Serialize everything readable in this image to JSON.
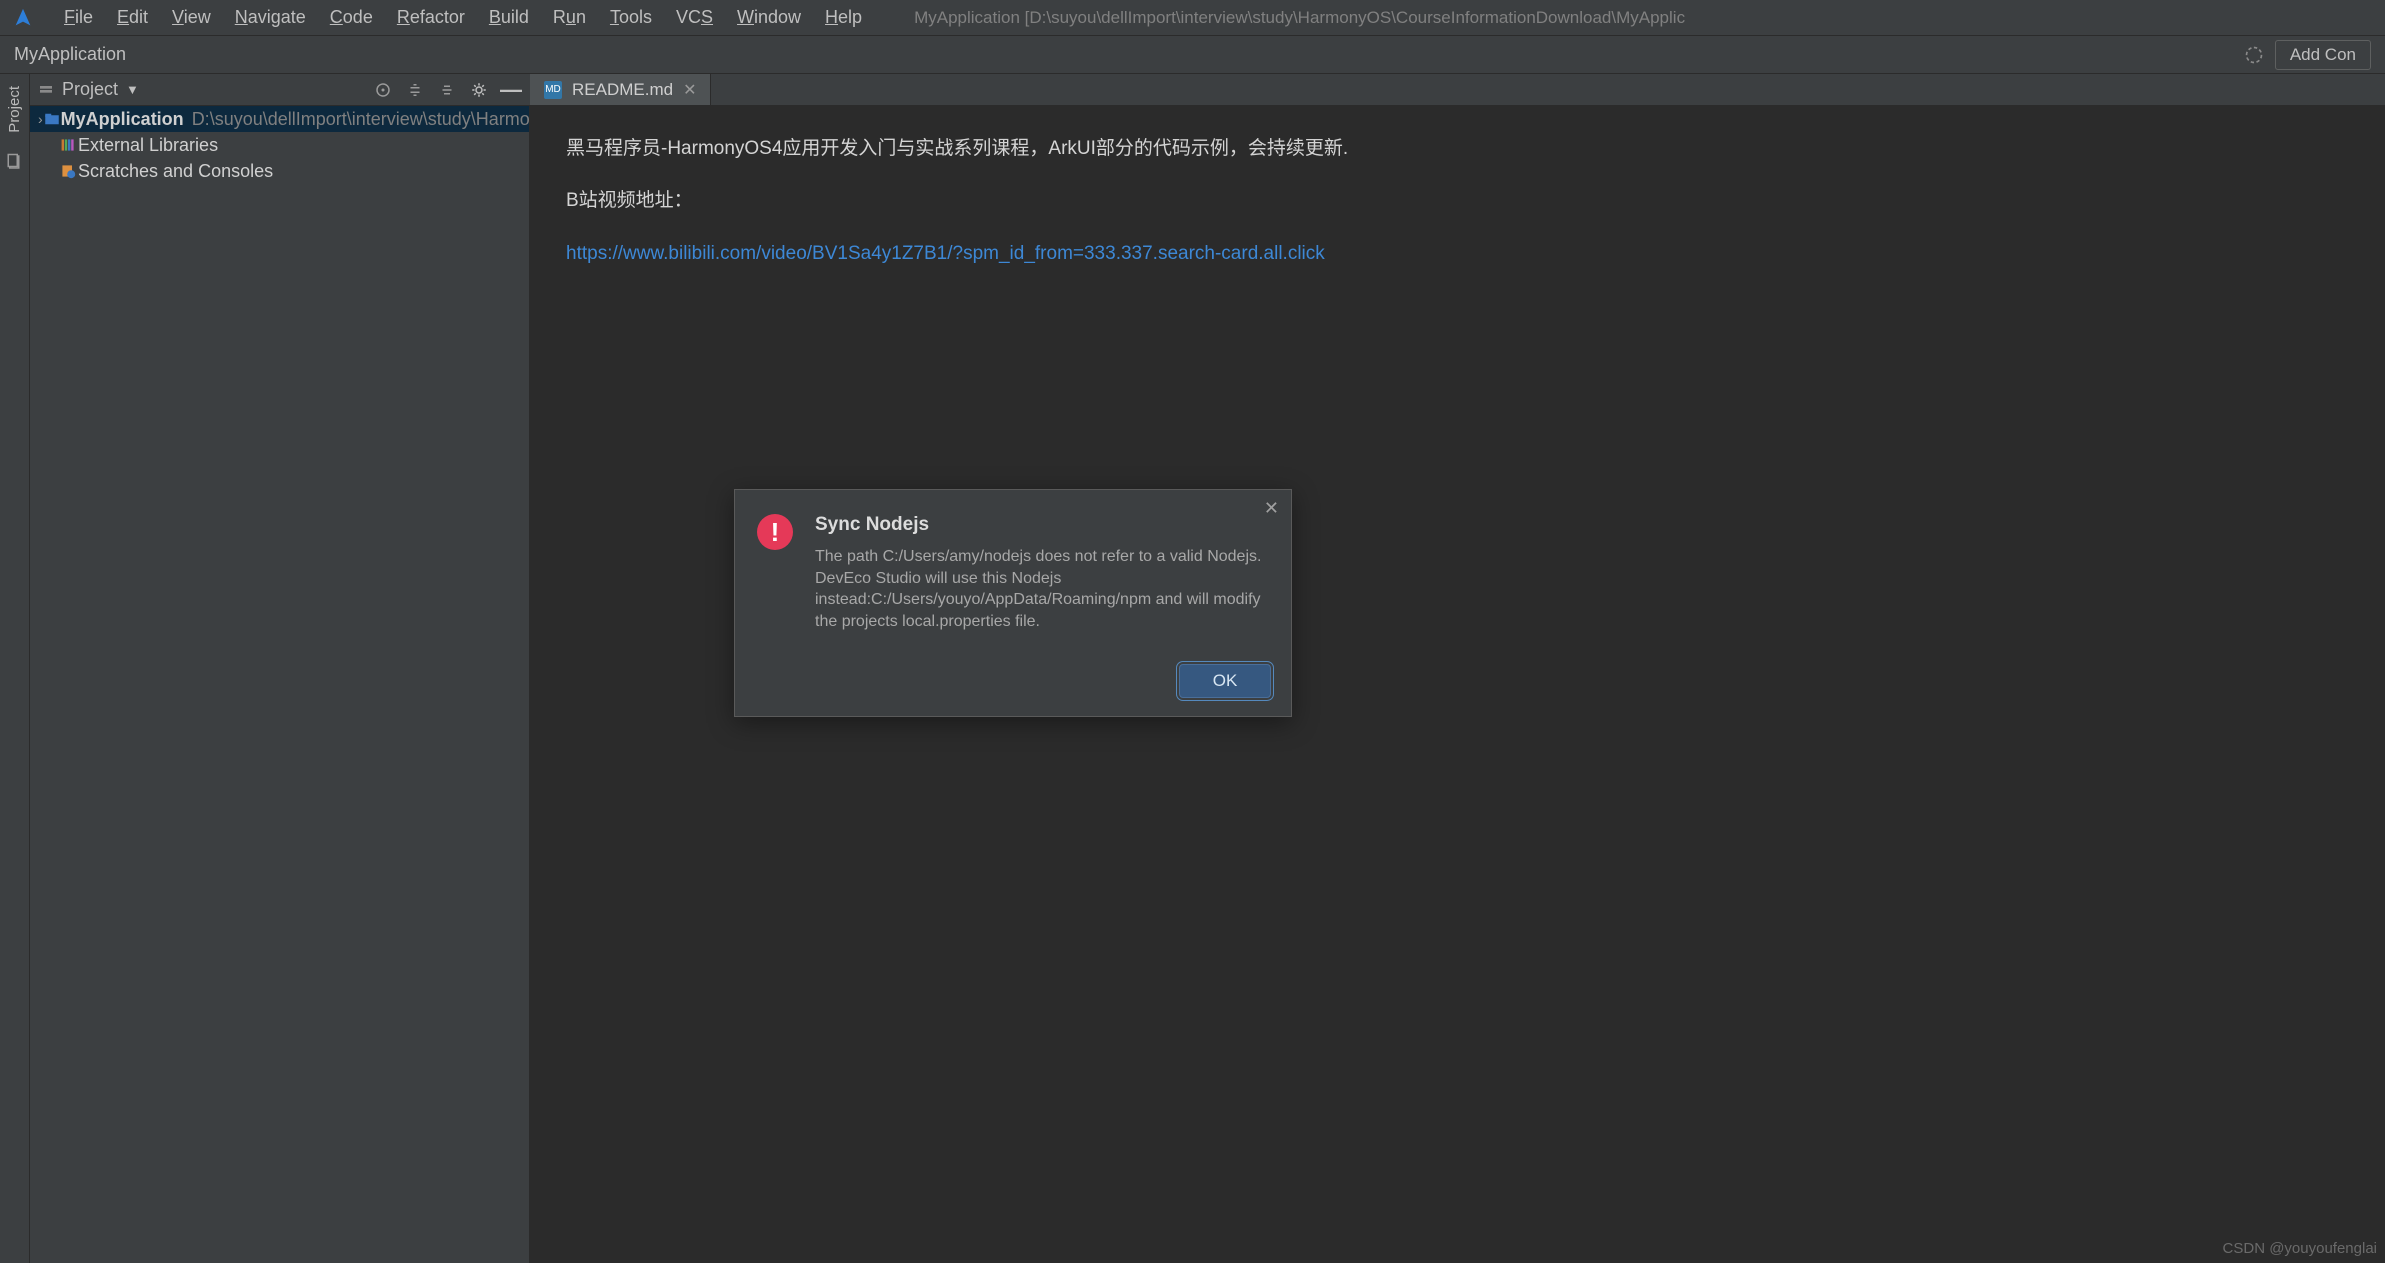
{
  "menu": {
    "items": [
      "File",
      "Edit",
      "View",
      "Navigate",
      "Code",
      "Refactor",
      "Build",
      "Run",
      "Tools",
      "VCS",
      "Window",
      "Help"
    ],
    "title_path": "MyApplication [D:\\suyou\\dellImport\\interview\\study\\HarmonyOS\\CourseInformationDownload\\MyApplic"
  },
  "navbar": {
    "crumb": "MyApplication",
    "add_config": "Add Con"
  },
  "left_strip": {
    "project_label": "Project"
  },
  "project_panel": {
    "title": "Project",
    "tree": {
      "root_name": "MyApplication",
      "root_path": "D:\\suyou\\dellImport\\interview\\study\\Harmon",
      "external": "External Libraries",
      "scratches": "Scratches and Consoles"
    }
  },
  "editor": {
    "tab": {
      "filename": "README.md",
      "icon": "MD"
    },
    "content": {
      "line1": "黑马程序员-HarmonyOS4应用开发入门与实战系列课程，ArkUI部分的代码示例，会持续更新.",
      "line2": "B站视频地址：",
      "link": "https://www.bilibili.com/video/BV1Sa4y1Z7B1/?spm_id_from=333.337.search-card.all.click"
    }
  },
  "dialog": {
    "title": "Sync Nodejs",
    "message": "The path C:/Users/amy/nodejs does not refer to a valid Nodejs. DevEco Studio will use this Nodejs instead:C:/Users/youyo/AppData/Roaming/npm and will modify the projects local.properties file.",
    "ok": "OK"
  },
  "watermark": "CSDN @youyoufenglai"
}
